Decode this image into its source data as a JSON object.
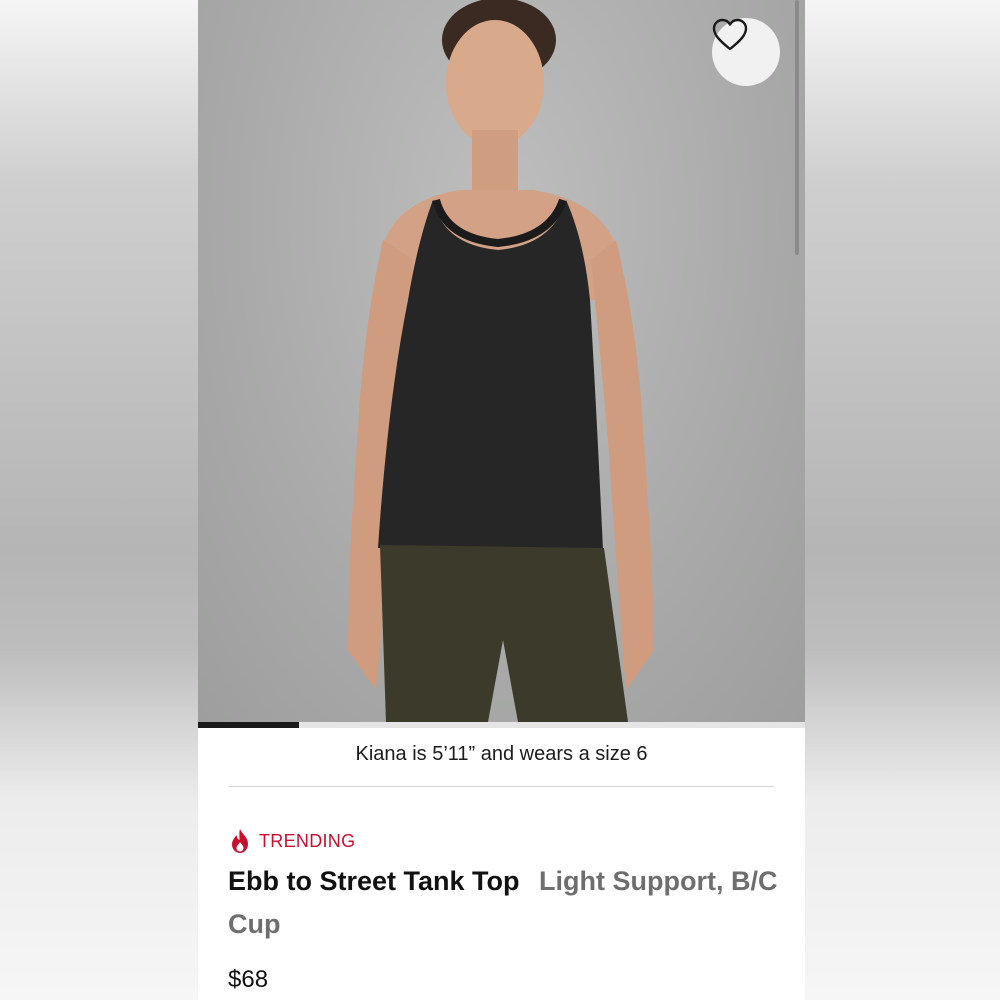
{
  "product": {
    "model_caption": "Kiana is 5’11” and wears a size 6",
    "badge": "TRENDING",
    "name": "Ebb to Street Tank Top",
    "subtitle": "Light Support, B/C Cup",
    "price": "$68"
  },
  "gallery": {
    "progress": 0.167
  },
  "icons": {
    "favorite": "heart-outline-icon",
    "trending": "flame-icon"
  },
  "colors": {
    "accent": "#c8102e",
    "title": "#111111",
    "subtitle": "#6e6e6e"
  }
}
